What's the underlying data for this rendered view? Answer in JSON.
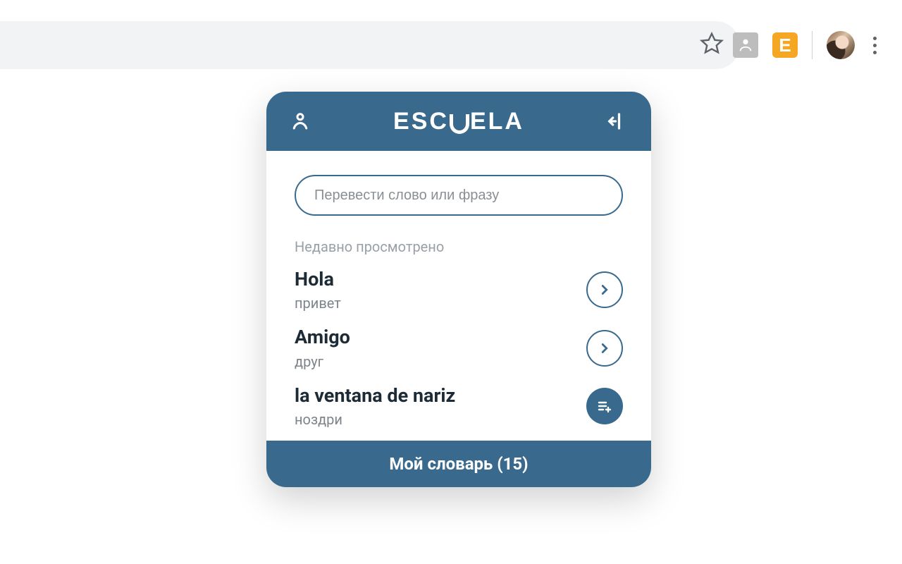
{
  "brand": "ESCUELA",
  "search": {
    "placeholder": "Перевести слово или фразу",
    "value": ""
  },
  "recent_label": "Недавно просмотрено",
  "entries": [
    {
      "word": "Hola",
      "translation": "привет",
      "action": "open"
    },
    {
      "word": "Amigo",
      "translation": "друг",
      "action": "open"
    },
    {
      "word": "la ventana de nariz",
      "translation": "ноздри",
      "action": "add"
    }
  ],
  "footer": {
    "label": "Мой словарь",
    "count": 15,
    "display": "Мой словарь (15)"
  },
  "toolbar": {
    "ext_e_label": "E"
  },
  "colors": {
    "brand": "#396a8d",
    "muted": "#9aa0a6",
    "text": "#1d2b36"
  }
}
